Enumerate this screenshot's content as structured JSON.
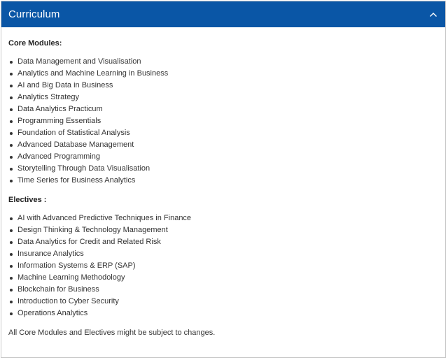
{
  "panel": {
    "title": "Curriculum",
    "toggle_icon": "chevron-up-icon",
    "header_color": "#0a56a6"
  },
  "core": {
    "heading": "Core Modules:",
    "items": [
      "Data Management and Visualisation",
      "Analytics and Machine Learning in Business",
      "AI and Big Data in Business",
      "Analytics Strategy",
      "Data Analytics Practicum",
      "Programming Essentials",
      "Foundation of Statistical Analysis",
      "Advanced Database Management",
      "Advanced Programming",
      "Storytelling Through Data Visualisation",
      "Time Series for Business Analytics"
    ]
  },
  "electives": {
    "heading": "Electives :",
    "items": [
      "AI with Advanced Predictive Techniques in Finance",
      "Design Thinking & Technology Management",
      "Data Analytics for Credit and Related Risk",
      "Insurance Analytics",
      "Information Systems & ERP (SAP)",
      "Machine Learning Methodology",
      "Blockchain for Business",
      "Introduction to Cyber Security",
      "Operations Analytics"
    ]
  },
  "footnote": "All Core Modules and Electives might be subject to changes."
}
